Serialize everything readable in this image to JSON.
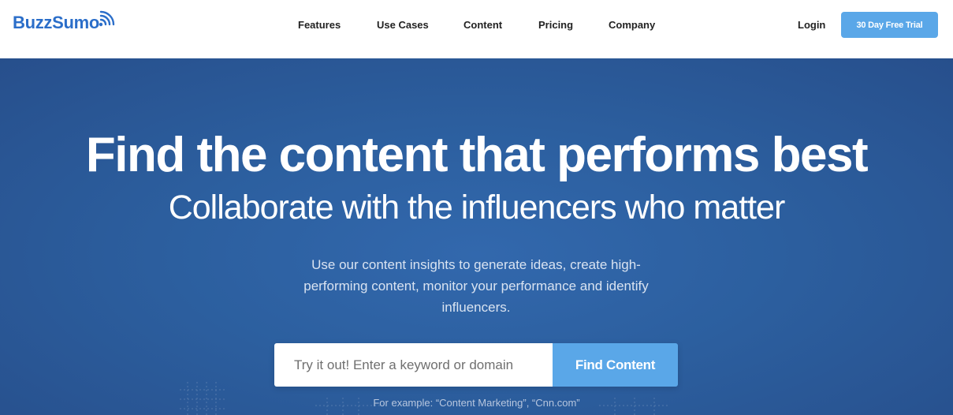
{
  "brand": {
    "name": "BuzzSumo",
    "color": "#2b6ec9"
  },
  "nav": {
    "items": [
      {
        "label": "Features"
      },
      {
        "label": "Use Cases"
      },
      {
        "label": "Content"
      },
      {
        "label": "Pricing"
      },
      {
        "label": "Company"
      }
    ],
    "login_label": "Login",
    "trial_label": "30 Day Free Trial"
  },
  "hero": {
    "headline": "Find the content that performs best",
    "subheadline": "Collaborate with the influencers who matter",
    "description": "Use our content insights to generate ideas, create high-performing content, monitor your performance and identify influencers.",
    "search": {
      "placeholder": "Try it out! Enter a keyword or domain",
      "button_label": "Find Content"
    },
    "example_text": "For example: “Content Marketing”, “Cnn.com”"
  },
  "colors": {
    "hero_background": "#2c5f9f",
    "accent_button": "#5aa7e8",
    "nav_text": "#222222"
  },
  "icons": {
    "logo_signal": "wifi-signal-icon"
  }
}
